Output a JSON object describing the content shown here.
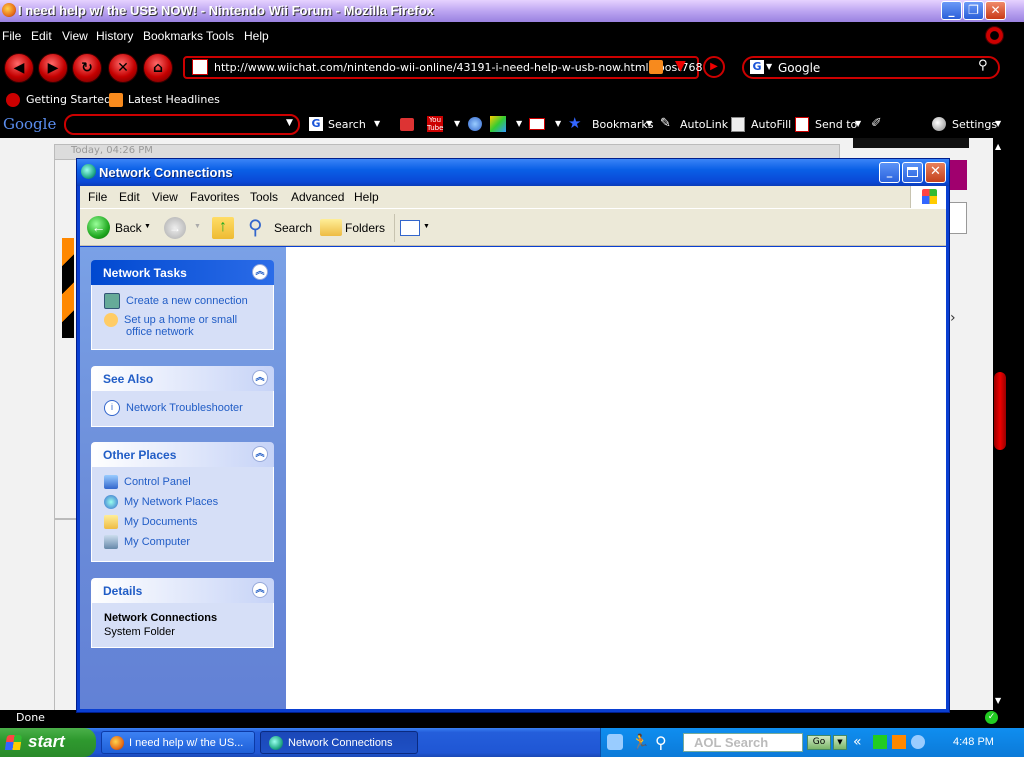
{
  "firefox": {
    "title": "I need help w/ the USB NOW! - Nintendo Wii Forum - Mozilla Firefox",
    "menu": [
      "File",
      "Edit",
      "View",
      "History",
      "Bookmarks",
      "Tools",
      "Help"
    ],
    "url": "http://www.wiichat.com/nintendo-wii-online/43191-i-need-help-w-usb-now.html#post768",
    "search_engine": "Google",
    "bookmarks": [
      "Getting Started",
      "Latest Headlines"
    ],
    "googlebar": {
      "logo": "Google",
      "search_label": "Search",
      "bookmarks_label": "Bookmarks",
      "autolink_label": "AutoLink",
      "autofill_label": "AutoFill",
      "sendto_label": "Send to",
      "settings_label": "Settings"
    },
    "status": "Done"
  },
  "webpage": {
    "post_time": "Today, 04:26 PM"
  },
  "window": {
    "title": "Network Connections",
    "menu": [
      "File",
      "Edit",
      "View",
      "Favorites",
      "Tools",
      "Advanced",
      "Help"
    ],
    "toolbar": {
      "back_label": "Back",
      "search_label": "Search",
      "folders_label": "Folders"
    },
    "panels": {
      "network_tasks": {
        "title": "Network Tasks",
        "items": [
          "Create a new connection",
          "Set up a home or small",
          "office network"
        ]
      },
      "see_also": {
        "title": "See Also",
        "items": [
          "Network Troubleshooter"
        ]
      },
      "other_places": {
        "title": "Other Places",
        "items": [
          "Control Panel",
          "My Network Places",
          "My Documents",
          "My Computer"
        ]
      },
      "details": {
        "title": "Details",
        "name": "Network Connections",
        "type": "System Folder"
      }
    }
  },
  "taskbar": {
    "start_label": "start",
    "tasks": [
      "I need help w/ the US...",
      "Network Connections"
    ],
    "aol_search": "AOL Search",
    "go_label": "Go",
    "clock": "4:48 PM"
  }
}
